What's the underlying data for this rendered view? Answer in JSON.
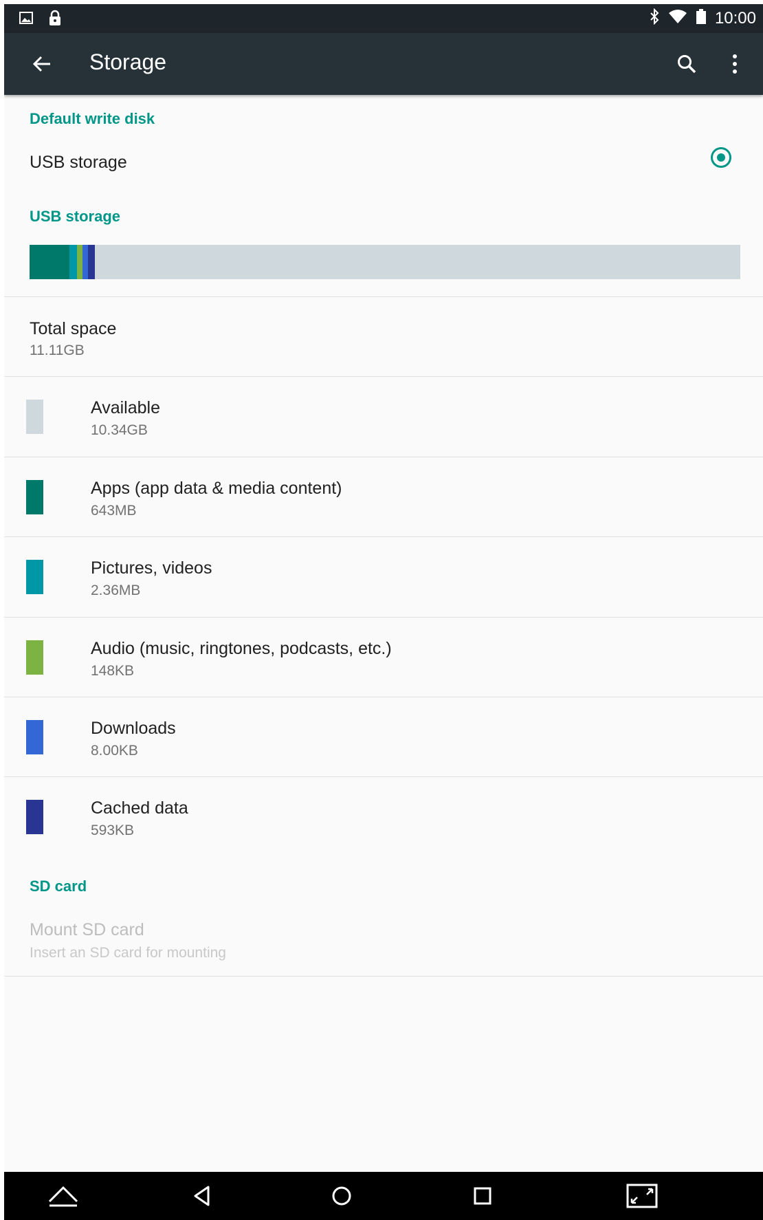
{
  "status_bar": {
    "time": "10:00",
    "left_icons": [
      "picture-icon",
      "lock-icon"
    ],
    "right_icons": [
      "bluetooth-icon",
      "wifi-icon",
      "battery-icon"
    ]
  },
  "app_bar": {
    "title": "Storage",
    "icons": [
      "back-arrow-icon",
      "search-icon",
      "more-vert-icon"
    ]
  },
  "default_write_disk": {
    "header": "Default write disk",
    "option_label": "USB storage",
    "selected": true
  },
  "usb_storage": {
    "header": "USB storage",
    "usage_bar": [
      {
        "name": "Apps",
        "fraction": 0.056,
        "color": "#00796b"
      },
      {
        "name": "Pictures, videos",
        "fraction": 0.011,
        "color": "#0097a7"
      },
      {
        "name": "Audio",
        "fraction": 0.008,
        "color": "#7cb342"
      },
      {
        "name": "Downloads",
        "fraction": 0.008,
        "color": "#3367d6"
      },
      {
        "name": "Cached data",
        "fraction": 0.01,
        "color": "#283593"
      }
    ],
    "total": {
      "label": "Total space",
      "value": "11.11GB"
    },
    "categories": [
      {
        "label": "Available",
        "value": "10.34GB",
        "color": "#cfd8dc"
      },
      {
        "label": "Apps (app data & media content)",
        "value": "643MB",
        "color": "#00796b"
      },
      {
        "label": "Pictures, videos",
        "value": "2.36MB",
        "color": "#0097a7"
      },
      {
        "label": "Audio (music, ringtones, podcasts, etc.)",
        "value": "148KB",
        "color": "#7cb342"
      },
      {
        "label": "Downloads",
        "value": "8.00KB",
        "color": "#3367d6"
      },
      {
        "label": "Cached data",
        "value": "593KB",
        "color": "#283593"
      }
    ]
  },
  "sd_card": {
    "header": "SD card",
    "mount_label": "Mount SD card",
    "mount_hint": "Insert an SD card for mounting"
  },
  "nav_bar": {
    "icons": [
      "home-up-icon",
      "back-icon",
      "home-icon",
      "recents-icon",
      "screen-resize-icon"
    ]
  }
}
